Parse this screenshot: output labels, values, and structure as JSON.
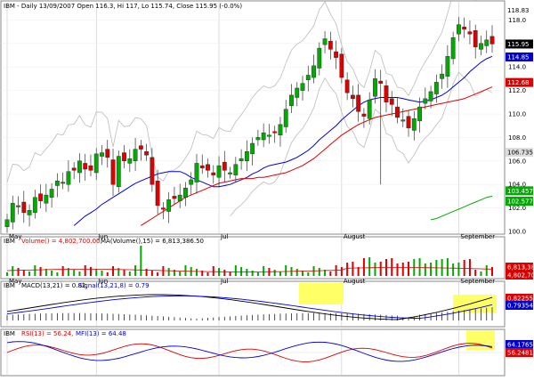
{
  "header": {
    "title": "IBM - Daily 13/09/2007 Open 116.3, Hi 117, Lo 115.74, Close 115.95 (-0.0%)"
  },
  "volume_header": {
    "symbol": "IBM",
    "volume_label": "Volume() = 4,802,700.00,",
    "ma_label": "MA(Volume(),15) = 6,813,386.50"
  },
  "macd_header": {
    "symbol": "IBM",
    "macd_label": "MACD(13,21) = 0.82,",
    "signal_label": "Signal(13,21,8) = 0.79"
  },
  "rsi_header": {
    "symbol": "IBM",
    "rsi_label": "RSI(13) = 56.24,",
    "mfi_label": "MFI(13) = 64.48"
  },
  "month_labels": [
    "May",
    "Jun",
    "Jul",
    "August",
    "September"
  ],
  "price_axis": [
    "118.0",
    "116.0",
    "114.0",
    "112.0",
    "110.0",
    "108.0",
    "106.0",
    "104.0",
    "102.0",
    "100.0"
  ],
  "price_badges": [
    "118.83",
    "115.95",
    "114.85",
    "112.68",
    "106.735",
    "103.457",
    "102.577"
  ],
  "volume_badges": [
    "6,813,386",
    "4,802,700"
  ],
  "macd_badges": [
    "0.822558",
    "0.793548"
  ],
  "rsi_badges": [
    "64.1765",
    "56.2481"
  ],
  "colors": {
    "up": "#00aa00",
    "down": "#dd0000",
    "ma_fast": "#0000dd",
    "ma_slow": "#dd0000",
    "ma_long": "#00aa00",
    "band": "#bbbbbb",
    "highlight": "#ffff66",
    "grid": "#c8c8c8"
  },
  "chart_data": {
    "type": "candlestick",
    "series": [
      {
        "name": "IBM",
        "values": [
          101.0,
          102.4,
          102.2,
          101.6,
          101.8,
          102.9,
          102.6,
          103.1,
          103.6,
          104.3,
          104.2,
          105.1,
          105.2,
          106.0,
          105.3,
          105.2,
          106.6,
          106.7,
          106.3,
          104.0,
          106.4,
          106.0,
          106.2,
          107.0,
          107.0,
          106.5,
          104.0,
          102.2,
          101.9,
          102.7,
          102.8,
          103.1,
          103.7,
          104.4,
          105.8,
          105.4,
          105.2,
          104.8,
          105.6,
          105.2,
          105.0,
          105.7,
          106.2,
          106.8,
          107.5,
          108.0,
          108.4,
          108.2,
          108.4,
          109.1,
          110.4,
          111.6,
          112.2,
          112.6,
          113.3,
          114.1,
          115.6,
          116.4,
          115.5,
          114.8,
          113.1,
          111.8,
          111.3,
          110.2,
          109.8,
          111.2,
          113.0,
          112.6,
          111.0,
          110.8,
          109.7,
          109.5,
          108.8,
          109.6,
          110.6,
          111.3,
          111.9,
          112.7,
          113.4,
          114.9,
          116.5,
          117.6,
          117.2,
          116.8,
          115.7,
          116.0,
          116.3,
          115.95
        ]
      },
      {
        "name": "MA fast",
        "values": [
          100.5,
          100.9,
          101.3,
          101.6,
          101.9,
          102.3,
          102.6,
          102.9,
          103.2,
          103.5,
          103.8,
          104.1,
          104.3,
          104.5,
          104.7,
          104.9,
          105.0,
          105.1,
          105.1,
          105.1,
          104.9,
          104.6,
          104.4,
          104.2,
          104.0,
          103.8,
          103.8,
          103.9,
          104.0,
          104.2,
          104.4,
          104.6,
          104.9,
          105.1,
          105.4,
          105.6,
          105.7,
          105.8,
          105.9,
          106.1,
          106.3,
          106.6,
          106.9,
          107.3,
          107.8,
          108.2,
          108.6,
          109.0,
          109.5,
          109.9,
          110.3,
          110.7,
          111.0,
          111.2,
          111.3,
          111.4,
          111.4,
          111.4,
          111.4,
          111.3,
          111.2,
          111.1,
          111.0,
          111.1,
          111.2,
          111.4,
          111.6,
          111.9,
          112.3,
          112.7,
          113.1,
          113.6,
          114.0,
          114.4,
          114.7,
          114.9
        ]
      },
      {
        "name": "MA slow",
        "values": [
          100.5,
          100.8,
          101.1,
          101.4,
          101.7,
          102.0,
          102.3,
          102.6,
          102.9,
          103.1,
          103.3,
          103.5,
          103.7,
          103.9,
          104.1,
          104.2,
          104.3,
          104.4,
          104.5,
          104.5,
          104.5,
          104.6,
          104.6,
          104.7,
          104.8,
          104.9,
          105.0,
          105.2,
          105.4,
          105.6,
          105.9,
          106.2,
          106.6,
          107.0,
          107.4,
          107.8,
          108.2,
          108.5,
          108.8,
          109.1,
          109.3,
          109.5,
          109.7,
          109.8,
          109.9,
          110.0,
          110.1,
          110.2,
          110.3,
          110.4,
          110.5,
          110.6,
          110.7,
          110.8,
          110.9,
          111.0,
          111.1,
          111.2,
          111.3,
          111.5,
          111.7,
          111.9,
          112.1,
          112.3
        ]
      },
      {
        "name": "MA long",
        "values": [
          101.0,
          101.1,
          101.3,
          101.5,
          101.7,
          101.9,
          102.1,
          102.3,
          102.5,
          102.7,
          102.9,
          103.0
        ]
      }
    ],
    "annotations": [
      "August spike low ~104.0"
    ],
    "ylim": [
      100,
      119
    ]
  }
}
